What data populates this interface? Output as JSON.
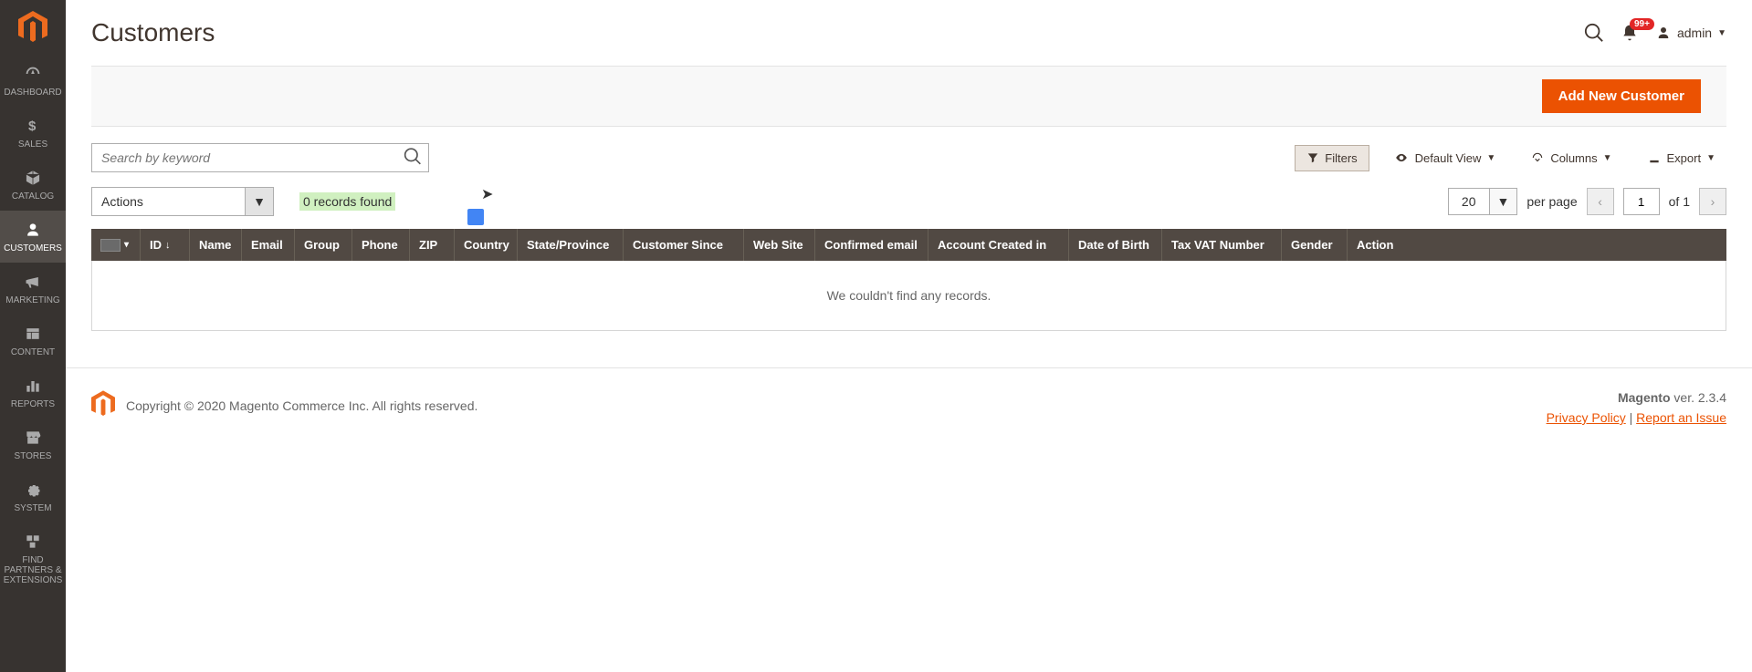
{
  "sidebar": {
    "items": [
      {
        "label": "DASHBOARD"
      },
      {
        "label": "SALES"
      },
      {
        "label": "CATALOG"
      },
      {
        "label": "CUSTOMERS"
      },
      {
        "label": "MARKETING"
      },
      {
        "label": "CONTENT"
      },
      {
        "label": "REPORTS"
      },
      {
        "label": "STORES"
      },
      {
        "label": "SYSTEM"
      },
      {
        "label": "FIND PARTNERS & EXTENSIONS"
      }
    ]
  },
  "header": {
    "title": "Customers",
    "notification_badge": "99+",
    "user": "admin"
  },
  "actions": {
    "add_button": "Add New Customer"
  },
  "toolbar": {
    "search_placeholder": "Search by keyword",
    "filters": "Filters",
    "default_view": "Default View",
    "columns": "Columns",
    "export": "Export"
  },
  "toolbar2": {
    "actions_label": "Actions",
    "records_found": "0 records found",
    "per_page_value": "20",
    "per_page_label": "per page",
    "page_value": "1",
    "of_label": "of 1"
  },
  "grid": {
    "columns": {
      "id": "ID",
      "name": "Name",
      "email": "Email",
      "group": "Group",
      "phone": "Phone",
      "zip": "ZIP",
      "country": "Country",
      "state": "State/Province",
      "since": "Customer Since",
      "web": "Web Site",
      "confirmed": "Confirmed email",
      "created": "Account Created in",
      "dob": "Date of Birth",
      "tax": "Tax VAT Number",
      "gender": "Gender",
      "action": "Action"
    },
    "empty": "We couldn't find any records."
  },
  "footer": {
    "copyright": "Copyright © 2020 Magento Commerce Inc. All rights reserved.",
    "brand": "Magento",
    "version": " ver. 2.3.4",
    "privacy": "Privacy Policy",
    "sep": " | ",
    "report": "Report an Issue"
  }
}
